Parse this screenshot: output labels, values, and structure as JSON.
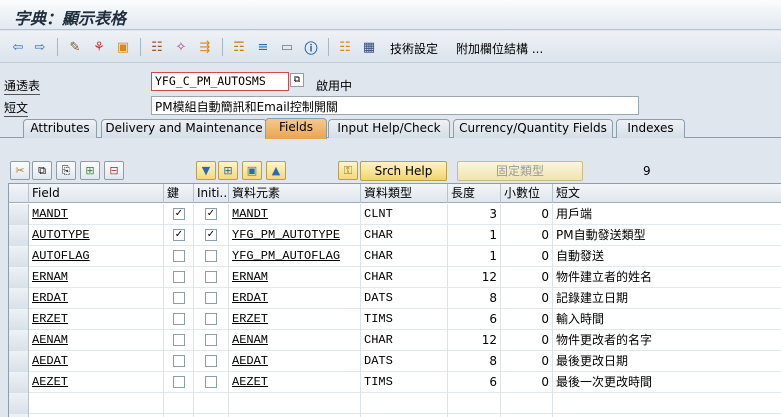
{
  "window": {
    "title": "字典：顯示表格"
  },
  "toolbar": {
    "tech_settings": "技術設定",
    "append_structure": "附加欄位結構 ..."
  },
  "header": {
    "table_label": "通透表",
    "table_name": "YFG_C_PM_AUTOSMS",
    "status": "啟用中",
    "short_text_label": "短文",
    "short_text": "PM模組自動簡訊和Email控制開關"
  },
  "tabs": [
    {
      "label": "Attributes"
    },
    {
      "label": "Delivery and Maintenance"
    },
    {
      "label": "Fields"
    },
    {
      "label": "Input Help/Check"
    },
    {
      "label": "Currency/Quantity Fields"
    },
    {
      "label": "Indexes"
    }
  ],
  "fields_panel": {
    "srch_help_label": "Srch Help",
    "builtin_type_label": "固定類型",
    "field_count": "9"
  },
  "table": {
    "columns": {
      "field": "Field",
      "key": "鍵",
      "init": "Initi...",
      "data_element": "資料元素",
      "data_type": "資料類型",
      "length": "長度",
      "decimals": "小數位",
      "short_text": "短文"
    },
    "rows": [
      {
        "field": "MANDT",
        "key": true,
        "init": true,
        "data_element": "MANDT",
        "data_type": "CLNT",
        "length": "3",
        "decimals": "0",
        "short_text": "用戶端"
      },
      {
        "field": "AUTOTYPE",
        "key": true,
        "init": true,
        "data_element": "YFG_PM_AUTOTYPE",
        "data_type": "CHAR",
        "length": "1",
        "decimals": "0",
        "short_text": "PM自動發送類型"
      },
      {
        "field": "AUTOFLAG",
        "key": false,
        "init": false,
        "data_element": "YFG_PM_AUTOFLAG",
        "data_type": "CHAR",
        "length": "1",
        "decimals": "0",
        "short_text": "自動發送"
      },
      {
        "field": "ERNAM",
        "key": false,
        "init": false,
        "data_element": "ERNAM",
        "data_type": "CHAR",
        "length": "12",
        "decimals": "0",
        "short_text": "物件建立者的姓名"
      },
      {
        "field": "ERDAT",
        "key": false,
        "init": false,
        "data_element": "ERDAT",
        "data_type": "DATS",
        "length": "8",
        "decimals": "0",
        "short_text": "記錄建立日期"
      },
      {
        "field": "ERZET",
        "key": false,
        "init": false,
        "data_element": "ERZET",
        "data_type": "TIMS",
        "length": "6",
        "decimals": "0",
        "short_text": "輸入時間"
      },
      {
        "field": "AENAM",
        "key": false,
        "init": false,
        "data_element": "AENAM",
        "data_type": "CHAR",
        "length": "12",
        "decimals": "0",
        "short_text": "物件更改者的名字"
      },
      {
        "field": "AEDAT",
        "key": false,
        "init": false,
        "data_element": "AEDAT",
        "data_type": "DATS",
        "length": "8",
        "decimals": "0",
        "short_text": "最後更改日期"
      },
      {
        "field": "AEZET",
        "key": false,
        "init": false,
        "data_element": "AEZET",
        "data_type": "TIMS",
        "length": "6",
        "decimals": "0",
        "short_text": "最後一次更改時間"
      }
    ]
  },
  "colors": {
    "active_tab": "#e8a550",
    "background": "#dfe6ee",
    "red_border": "#d24a4a"
  }
}
